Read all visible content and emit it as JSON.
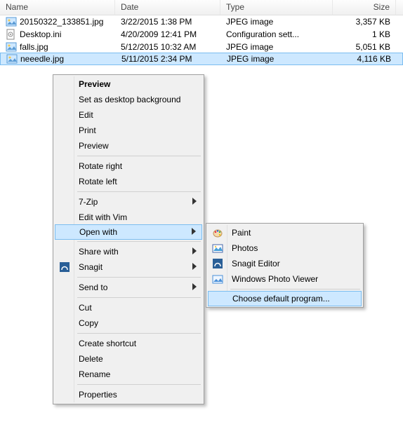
{
  "columns": {
    "name": "Name",
    "date": "Date",
    "type": "Type",
    "size": "Size"
  },
  "files": [
    {
      "name": "20150322_133851.jpg",
      "date": "3/22/2015 1:38 PM",
      "type": "JPEG image",
      "size": "3,357 KB",
      "kind": "jpg"
    },
    {
      "name": "Desktop.ini",
      "date": "4/20/2009 12:41 PM",
      "type": "Configuration sett...",
      "size": "1 KB",
      "kind": "ini"
    },
    {
      "name": "falls.jpg",
      "date": "5/12/2015 10:32 AM",
      "type": "JPEG image",
      "size": "5,051 KB",
      "kind": "jpg"
    },
    {
      "name": "neeedle.jpg",
      "date": "5/11/2015 2:34 PM",
      "type": "JPEG image",
      "size": "4,116 KB",
      "kind": "jpg"
    }
  ],
  "context_menu": {
    "preview_bold": "Preview",
    "set_bg": "Set as desktop background",
    "edit": "Edit",
    "print": "Print",
    "preview": "Preview",
    "rotate_right": "Rotate right",
    "rotate_left": "Rotate left",
    "seven_zip": "7-Zip",
    "edit_vim": "Edit with Vim",
    "open_with": "Open with",
    "share_with": "Share with",
    "snagit": "Snagit",
    "send_to": "Send to",
    "cut": "Cut",
    "copy": "Copy",
    "create_shortcut": "Create shortcut",
    "delete": "Delete",
    "rename": "Rename",
    "properties": "Properties"
  },
  "open_with_submenu": {
    "paint": "Paint",
    "photos": "Photos",
    "snagit_editor": "Snagit Editor",
    "photo_viewer": "Windows Photo Viewer",
    "choose_default": "Choose default program..."
  }
}
